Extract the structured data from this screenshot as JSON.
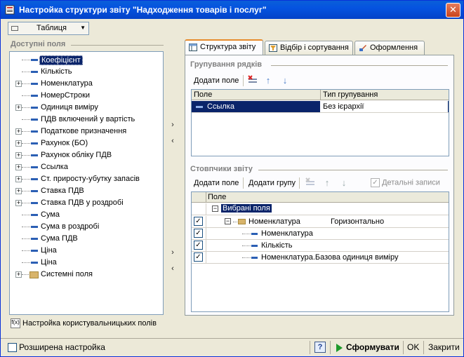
{
  "window": {
    "title": "Настройка структури звіту \"Надходження товарів і послуг\"",
    "close_glyph": "✕"
  },
  "view_select": {
    "value": "Таблиця"
  },
  "available_fields": {
    "label": "Доступні поля",
    "items": [
      {
        "label": "Коефіцієнт",
        "expandable": false,
        "folder": false,
        "selected": true
      },
      {
        "label": "Кількість",
        "expandable": false,
        "folder": false,
        "selected": false
      },
      {
        "label": "Номенклатура",
        "expandable": true,
        "folder": false,
        "selected": false
      },
      {
        "label": "НомерСтроки",
        "expandable": false,
        "folder": false,
        "selected": false
      },
      {
        "label": "Одиниця виміру",
        "expandable": true,
        "folder": false,
        "selected": false
      },
      {
        "label": "ПДВ включений у вартість",
        "expandable": false,
        "folder": false,
        "selected": false
      },
      {
        "label": "Податкове призначення",
        "expandable": true,
        "folder": false,
        "selected": false
      },
      {
        "label": "Рахунок (БО)",
        "expandable": true,
        "folder": false,
        "selected": false
      },
      {
        "label": "Рахунок обліку ПДВ",
        "expandable": true,
        "folder": false,
        "selected": false
      },
      {
        "label": "Ссылка",
        "expandable": true,
        "folder": false,
        "selected": false
      },
      {
        "label": "Ст. приросту-убутку запасів",
        "expandable": true,
        "folder": false,
        "selected": false
      },
      {
        "label": "Ставка ПДВ",
        "expandable": true,
        "folder": false,
        "selected": false
      },
      {
        "label": "Ставка ПДВ у роздробі",
        "expandable": true,
        "folder": false,
        "selected": false
      },
      {
        "label": "Сума",
        "expandable": false,
        "folder": false,
        "selected": false
      },
      {
        "label": "Сума в роздробі",
        "expandable": false,
        "folder": false,
        "selected": false
      },
      {
        "label": "Сума ПДВ",
        "expandable": false,
        "folder": false,
        "selected": false
      },
      {
        "label": "Ціна",
        "expandable": false,
        "folder": false,
        "selected": false
      },
      {
        "label": "Ціна",
        "expandable": false,
        "folder": false,
        "selected": false
      },
      {
        "label": "Системні поля",
        "expandable": true,
        "folder": true,
        "selected": false
      }
    ],
    "custom_fields_label": "Настройка користувальницьких полів",
    "custom_fields_icon_text": "f(x)"
  },
  "move_arrows": {
    "right": "›",
    "left": "‹"
  },
  "tabs": [
    {
      "label": "Структура звіту",
      "active": true
    },
    {
      "label": "Відбір і сортування",
      "active": false
    },
    {
      "label": "Оформлення",
      "active": false
    }
  ],
  "row_grouping": {
    "label": "Групування рядків",
    "add_field_label": "Додати поле",
    "columns": [
      "Поле",
      "Тип групування"
    ],
    "rows": [
      {
        "field": "Ссылка",
        "type": "Без ієрархії",
        "selected": true
      }
    ]
  },
  "columns_section": {
    "label": "Стовпчики звіту",
    "add_field_label": "Додати поле",
    "add_group_label": "Додати групу",
    "detail_records_label": "Детальні записи",
    "column_header": "Поле",
    "root_label": "Вибрані поля",
    "rows": [
      {
        "label": "Номенклатура",
        "extra": "Горизонтально",
        "checked": true,
        "level": 1,
        "folder": true
      },
      {
        "label": "Номенклатура",
        "extra": "",
        "checked": true,
        "level": 2,
        "folder": false
      },
      {
        "label": "Кількість",
        "extra": "",
        "checked": true,
        "level": 2,
        "folder": false
      },
      {
        "label": "Номенклатура.Базова одиниця виміру",
        "extra": "",
        "checked": true,
        "level": 2,
        "folder": false
      }
    ]
  },
  "footer": {
    "advanced_label": "Розширена настройка",
    "help_glyph": "?",
    "generate_label": "Сформувати",
    "ok_label": "OK",
    "close_label": "Закрити"
  },
  "glyphs": {
    "plus": "+",
    "minus": "−",
    "check": "✓",
    "up": "↑",
    "down": "↓",
    "dropdown": "▼"
  }
}
